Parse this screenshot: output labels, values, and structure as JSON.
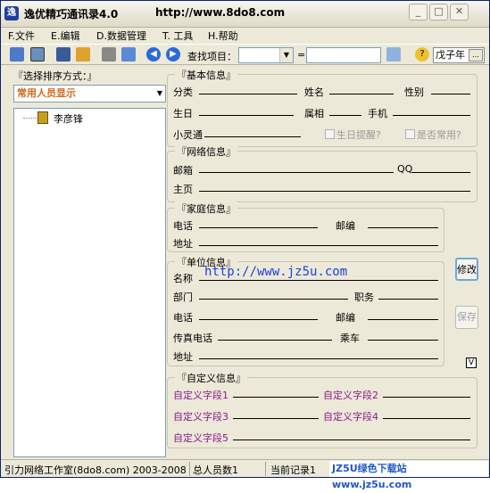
{
  "window": {
    "title": "逸优精巧通讯录4.0",
    "url": "http://www.8do8.com"
  },
  "menu": [
    "F.文件",
    "E.编辑",
    "D.数据管理",
    "T. 工具",
    "H.帮助"
  ],
  "toolbar": {
    "search_label": "查找项目：",
    "date_value": "戊子年"
  },
  "left_panel": {
    "sort_label": "『选择排序方式：』",
    "sort_value": "常用人员显示",
    "tree_item": "李彦锋"
  },
  "basic": {
    "title": "『基本信息』",
    "category": "分类",
    "name": "姓名",
    "gender": "性别",
    "birthday": "生日",
    "zodiac": "属相",
    "mobile": "手机",
    "phs": "小灵通",
    "birthday_reminder": "生日提醒?",
    "is_frequent": "是否常用?"
  },
  "network": {
    "title": "『网络信息』",
    "email": "邮箱",
    "qq": "QQ",
    "homepage": "主页"
  },
  "family": {
    "title": "『家庭信息』",
    "phone": "电话",
    "postcode": "邮编",
    "address": "地址"
  },
  "work": {
    "title": "『单位信息』",
    "company": "名称",
    "department": "部门",
    "position": "职务",
    "phone": "电话",
    "postcode": "邮编",
    "fax": "传真电话",
    "route": "乘车",
    "address": "地址",
    "watermark": "http://www.jz5u.com"
  },
  "buttons": {
    "edit": "修改",
    "save": "保存",
    "check": "V"
  },
  "custom": {
    "title": "『自定义信息』",
    "field1": "自定义字段1",
    "field2": "自定义字段2",
    "field3": "自定义字段3",
    "field4": "自定义字段4",
    "field5": "自定义字段5"
  },
  "status": {
    "studio": "引力网络工作室(8do8.com) 2003-2008",
    "total": "总人员数1",
    "current": "当前记录1",
    "badge": "JZ5U绿色下载站 www.jz5u.com"
  }
}
